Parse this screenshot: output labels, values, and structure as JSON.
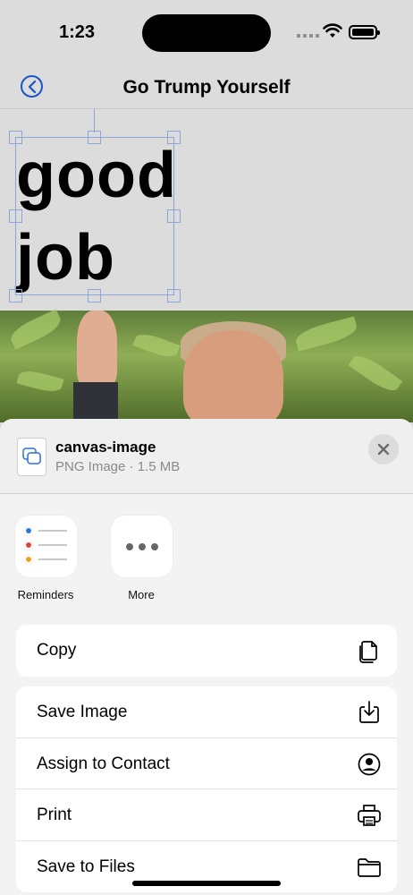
{
  "status_bar": {
    "time": "1:23"
  },
  "nav": {
    "title": "Go Trump Yourself",
    "back_icon": "chevron-left-circle-icon",
    "accent": "#1a55c8"
  },
  "canvas": {
    "text_line1": "good",
    "text_line2": "job"
  },
  "share_sheet": {
    "file_name": "canvas-image",
    "file_info": "PNG Image · 1.5 MB",
    "apps": [
      {
        "label": "Reminders",
        "icon": "reminders-icon"
      },
      {
        "label": "More",
        "icon": "more-icon"
      }
    ],
    "actions_group1": [
      {
        "label": "Copy",
        "icon": "copy-icon"
      }
    ],
    "actions_group2": [
      {
        "label": "Save Image",
        "icon": "save-image-icon"
      },
      {
        "label": "Assign to Contact",
        "icon": "contact-icon"
      },
      {
        "label": "Print",
        "icon": "printer-icon"
      },
      {
        "label": "Save to Files",
        "icon": "folder-icon"
      }
    ]
  }
}
